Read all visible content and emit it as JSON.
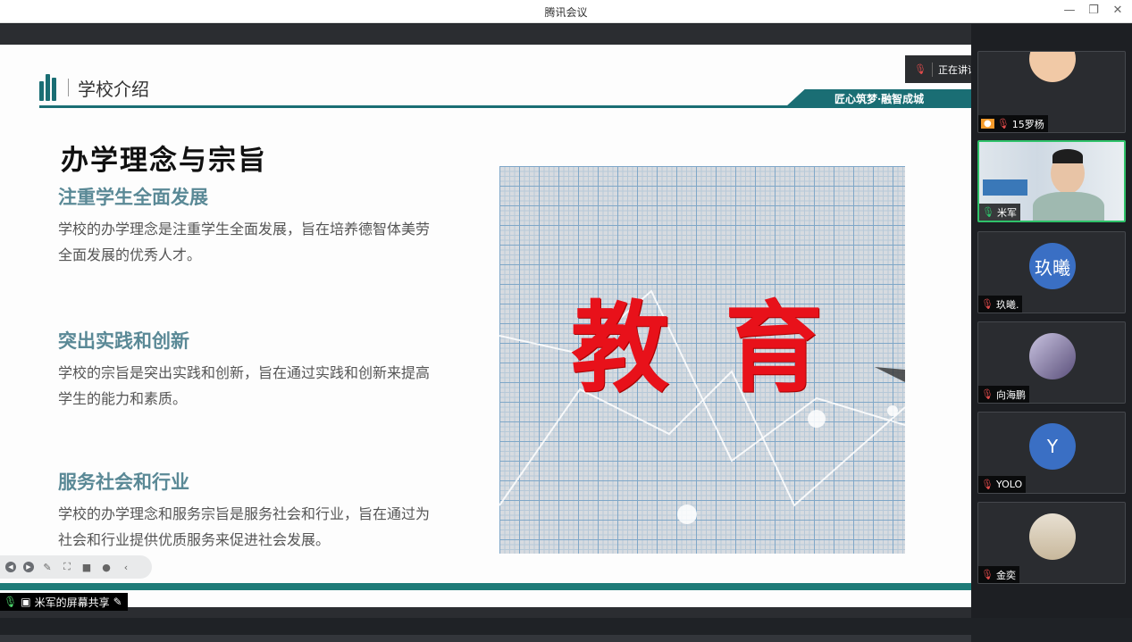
{
  "window": {
    "title": "腾讯会议",
    "minimize": "—",
    "restore": "❐",
    "close": "✕"
  },
  "slide": {
    "section_title": "学校介绍",
    "slogan": "匠心筑梦·融智成城",
    "heading": "办学理念与宗旨",
    "points": [
      {
        "title": "注重学生全面发展",
        "body": "学校的办学理念是注重学生全面发展，旨在培养德智体美劳全面发展的优秀人才。"
      },
      {
        "title": "突出实践和创新",
        "body": "学校的宗旨是突出实践和创新，旨在通过实践和创新来提高学生的能力和素质。"
      },
      {
        "title": "服务社会和行业",
        "body": "学校的办学理念和服务宗旨是服务社会和行业，旨在通过为社会和行业提供优质服务来促进社会发展。"
      }
    ],
    "image_text": "教育"
  },
  "share": {
    "label": "米军的屏幕共享"
  },
  "speaking": {
    "label": "正在讲话：米军;"
  },
  "participants": [
    {
      "name": "15罗杨",
      "mic": "muted"
    },
    {
      "name": "米军",
      "mic": "on"
    },
    {
      "name": "玖曦.",
      "avatar_text": "玖曦",
      "avatar_color": "#3a6fc4",
      "mic": "muted"
    },
    {
      "name": "向海鹏",
      "mic": "muted"
    },
    {
      "name": "YOLO",
      "avatar_text": "Y",
      "avatar_color": "#3a6fc4",
      "mic": "muted"
    },
    {
      "name": "金奕",
      "mic": "muted"
    }
  ],
  "colors": {
    "accent": "#1a6e74",
    "point_title": "#5a8996",
    "edu_red": "#e8111a",
    "active_border": "#2fc26a"
  }
}
